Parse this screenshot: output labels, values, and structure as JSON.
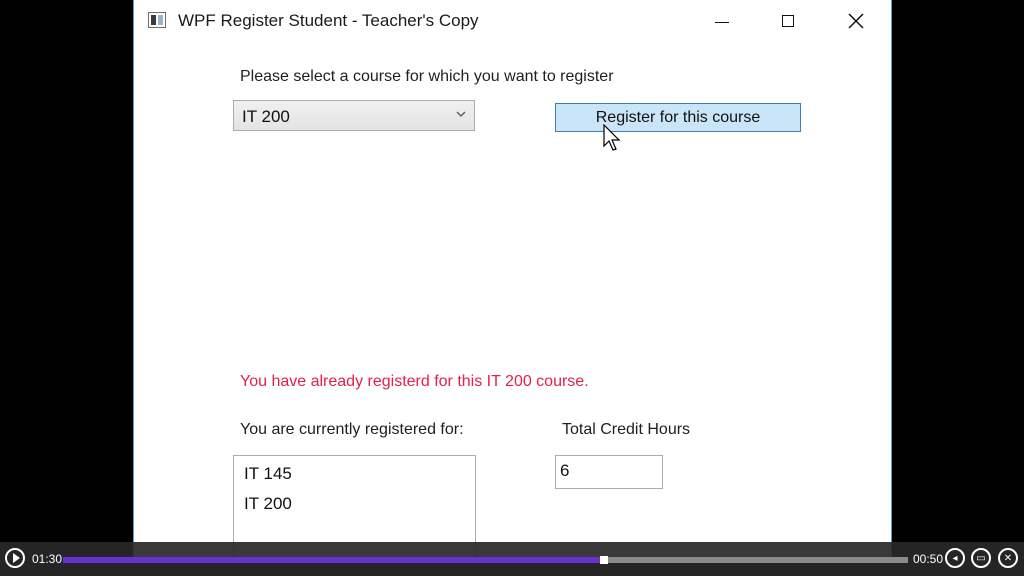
{
  "window": {
    "title": "WPF Register Student - Teacher's Copy",
    "controls": {
      "minimize": "minimize-icon",
      "maximize": "maximize-icon",
      "close": "close-icon"
    }
  },
  "form": {
    "course_prompt": "Please select a course for which you want to register",
    "course_select_value": "IT 200",
    "register_button_label": "Register for this course",
    "error_message": "You have already registerd for this IT 200 course.",
    "registered_label": "You are currently registered for:",
    "registered_courses": [
      "IT 145",
      "IT 200"
    ],
    "credit_hours_label": "Total Credit Hours",
    "credit_hours_value": "6"
  },
  "player": {
    "elapsed": "01:30",
    "remaining": "00:50",
    "progress": 0.64,
    "colors": {
      "progress_fill": "#6a2fcf",
      "track": "#8a8a8a",
      "error_text": "#e81f49",
      "button_bg": "#c9e5f7"
    }
  }
}
